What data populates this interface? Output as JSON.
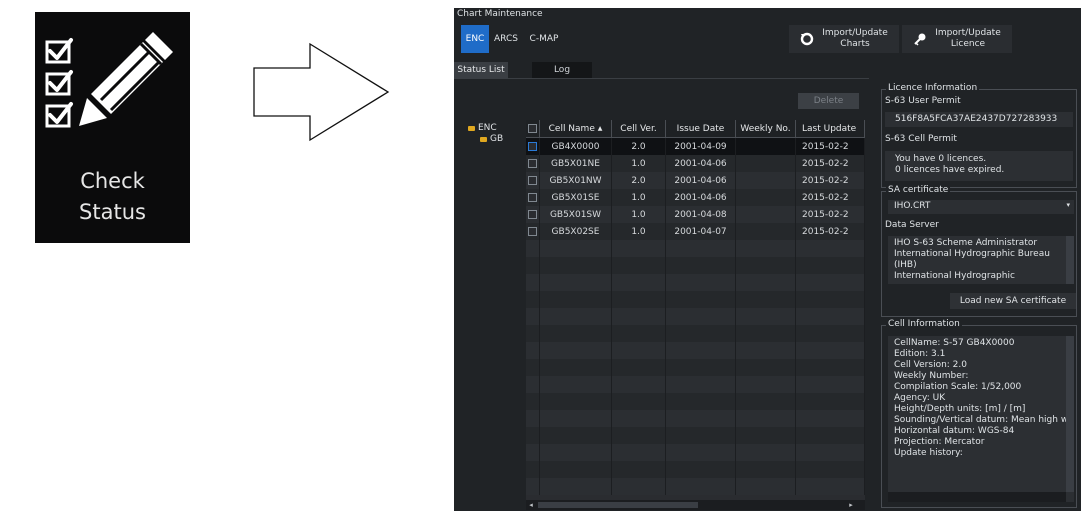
{
  "launcher": {
    "label_line1": "Check",
    "label_line2": "Status",
    "icon": "checklist-pencil-icon"
  },
  "arrow": {
    "icon": "right-arrow-icon"
  },
  "window": {
    "title": "Chart Maintenance",
    "toolbar": {
      "enc": "ENC",
      "arcs": "ARCS",
      "cmap": "C-MAP",
      "import_charts_line1": "Import/Update",
      "import_charts_line2": "Charts",
      "import_licence_line1": "Import/Update",
      "import_licence_line2": "Licence"
    },
    "tabs": {
      "status_list": "Status List",
      "log": "Log"
    },
    "delete_label": "Delete",
    "tree": {
      "root": "ENC",
      "child": "GB"
    },
    "table": {
      "columns": [
        "Cell Name",
        "Cell Ver.",
        "Issue Date",
        "Weekly No.",
        "Last Update"
      ],
      "sort_indicator": "▲",
      "rows": [
        {
          "cell": "GB4X0000",
          "ver": "2.0",
          "issue": "2001-04-09",
          "weekly": "",
          "last": "2015-02-2"
        },
        {
          "cell": "GB5X01NE",
          "ver": "1.0",
          "issue": "2001-04-06",
          "weekly": "",
          "last": "2015-02-2"
        },
        {
          "cell": "GB5X01NW",
          "ver": "2.0",
          "issue": "2001-04-06",
          "weekly": "",
          "last": "2015-02-2"
        },
        {
          "cell": "GB5X01SE",
          "ver": "1.0",
          "issue": "2001-04-06",
          "weekly": "",
          "last": "2015-02-2"
        },
        {
          "cell": "GB5X01SW",
          "ver": "1.0",
          "issue": "2001-04-08",
          "weekly": "",
          "last": "2015-02-2"
        },
        {
          "cell": "GB5X02SE",
          "ver": "1.0",
          "issue": "2001-04-07",
          "weekly": "",
          "last": "2015-02-2"
        }
      ]
    },
    "licence": {
      "legend": "Licence Information",
      "user_permit_label": "S-63 User Permit",
      "user_permit_value": "516F8A5FCA37AE2437D727283933",
      "cell_permit_label": "S-63 Cell Permit",
      "cell_permit_line1": "You have 0 licences.",
      "cell_permit_line2": "0 licences have expired."
    },
    "sa": {
      "legend": "SA certificate",
      "selected": "IHO.CRT",
      "data_server_label": "Data Server",
      "server_lines": [
        "IHO S-63 Scheme Administrator",
        "International Hydrographic Bureau",
        "(IHB)",
        "International Hydrographic"
      ],
      "load_button": "Load new SA certificate"
    },
    "cell_info": {
      "legend": "Cell Information",
      "lines": [
        "CellName: S-57 GB4X0000",
        "Edition: 3.1",
        "Cell Version: 2.0",
        "Weekly Number:",
        "Compilation Scale: 1/52,000",
        "Agency: UK",
        "Height/Depth units: [m] / [m]",
        "Sounding/Vertical datum: Mean high w",
        "Horizontal datum: WGS-84",
        "Projection: Mercator",
        "Update history:"
      ]
    },
    "colors": {
      "accent": "#1f6cc8",
      "background": "#202326",
      "folder": "#e0a820"
    }
  }
}
